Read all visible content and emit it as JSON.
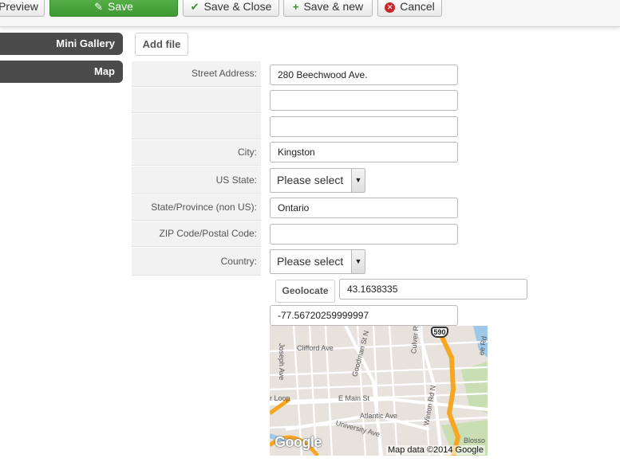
{
  "toolbar": {
    "preview_label": "Preview",
    "save_label": "Save",
    "save_close_label": "Save & Close",
    "save_new_label": "Save & new",
    "cancel_label": "Cancel"
  },
  "sidebar": {
    "tabs": [
      {
        "label": "Mini Gallery"
      },
      {
        "label": "Map"
      }
    ]
  },
  "add_file_label": "Add file",
  "form": {
    "street_label": "Street Address:",
    "street_value": "280 Beechwood Ave.",
    "street2_value": "",
    "street3_value": "",
    "city_label": "City:",
    "city_value": "Kingston",
    "us_state_label": "US State:",
    "us_state_value": "Please select",
    "province_label": "State/Province (non US):",
    "province_value": "Ontario",
    "zip_label": "ZIP Code/Postal Code:",
    "zip_value": "",
    "country_label": "Country:",
    "country_value": "Please select"
  },
  "geo": {
    "geolocate_label": "Geolocate",
    "latitude": "43.1638335",
    "longitude": "-77.56720259999997"
  },
  "map": {
    "labels": {
      "clifford": "Clifford Ave",
      "joseph": "Joseph Ave",
      "goodman": "Goodman St N",
      "culver": "Culver Rd",
      "main": "E Main St",
      "atlantic": "Atlantic Ave",
      "university": "University Ave",
      "winton": "Winton Rd N",
      "loop": "r Loop",
      "blosso": "Blosso",
      "lee": "ee Rd"
    },
    "highway_shield": "590",
    "logo": "Google",
    "credit": "Map data ©2014 Google"
  },
  "colors": {
    "save_green": "#47a23a",
    "tab_dark": "#4b4b4b",
    "highway_orange": "#f5a623",
    "water_blue": "#9ec8e8",
    "park_green": "#c9dfb3"
  }
}
